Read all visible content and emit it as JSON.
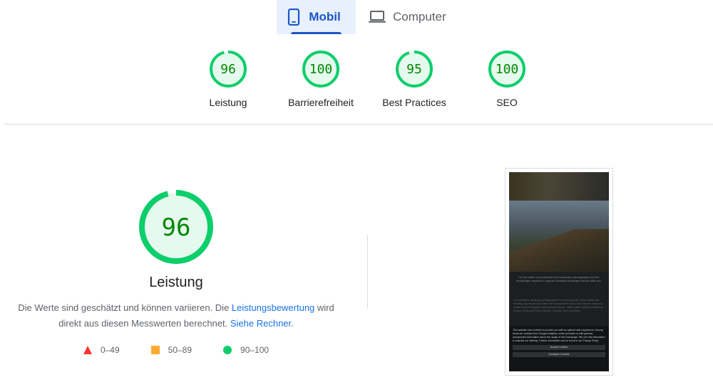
{
  "tabs": [
    {
      "label": "Mobil",
      "active": true
    },
    {
      "label": "Computer",
      "active": false
    }
  ],
  "scores": [
    {
      "value": "96",
      "label": "Leistung"
    },
    {
      "value": "100",
      "label": "Barrierefreiheit"
    },
    {
      "value": "95",
      "label": "Best Practices"
    },
    {
      "value": "100",
      "label": "SEO"
    }
  ],
  "main": {
    "score": "96",
    "title": "Leistung",
    "desc_1": "Die Werte sind geschätzt und können variieren. Die ",
    "link_1": "Leistungsbewertung",
    "desc_2": " wird direkt aus diesen Messwerten berechnet. ",
    "link_2": "Siehe Rechner",
    "desc_3": "."
  },
  "legend": [
    {
      "range": "0–49",
      "color": "#ff3333",
      "icon": "triangle-icon"
    },
    {
      "range": "50–89",
      "color": "#ffaa33",
      "icon": "square-icon"
    },
    {
      "range": "90–100",
      "color": "#0cce6b",
      "icon": "circle-icon"
    }
  ],
  "phone": {
    "headline": "Let me share my excitement for landscape photography and the knowledge required to capture beautiful landscape photos with you.",
    "body": "I'm a freelance landscape photographer from Germany with Swiss nature and traveling. My travels have taken me all around the world, and I had the chance to explore and photograph many beautiful places. I have visited various countries in Europe, North and South America, Oceania, Asia, and Africa.",
    "cookie_text": "This website uses cookies to provide you with an optimal user experience. Among those are cookies from Google Analytics, which provides us with general, anonymized information about the usage of this homepage. We use this information to improve our offering. Further information can be found in our Privacy Policy.",
    "accept_label": "Accept Cookies",
    "configure_label": "Configure Cookies"
  },
  "colors": {
    "pass": "#0cce6b",
    "pass_text": "#008800",
    "pass_fill": "#e6f9ee",
    "accent": "#1a56c5"
  }
}
